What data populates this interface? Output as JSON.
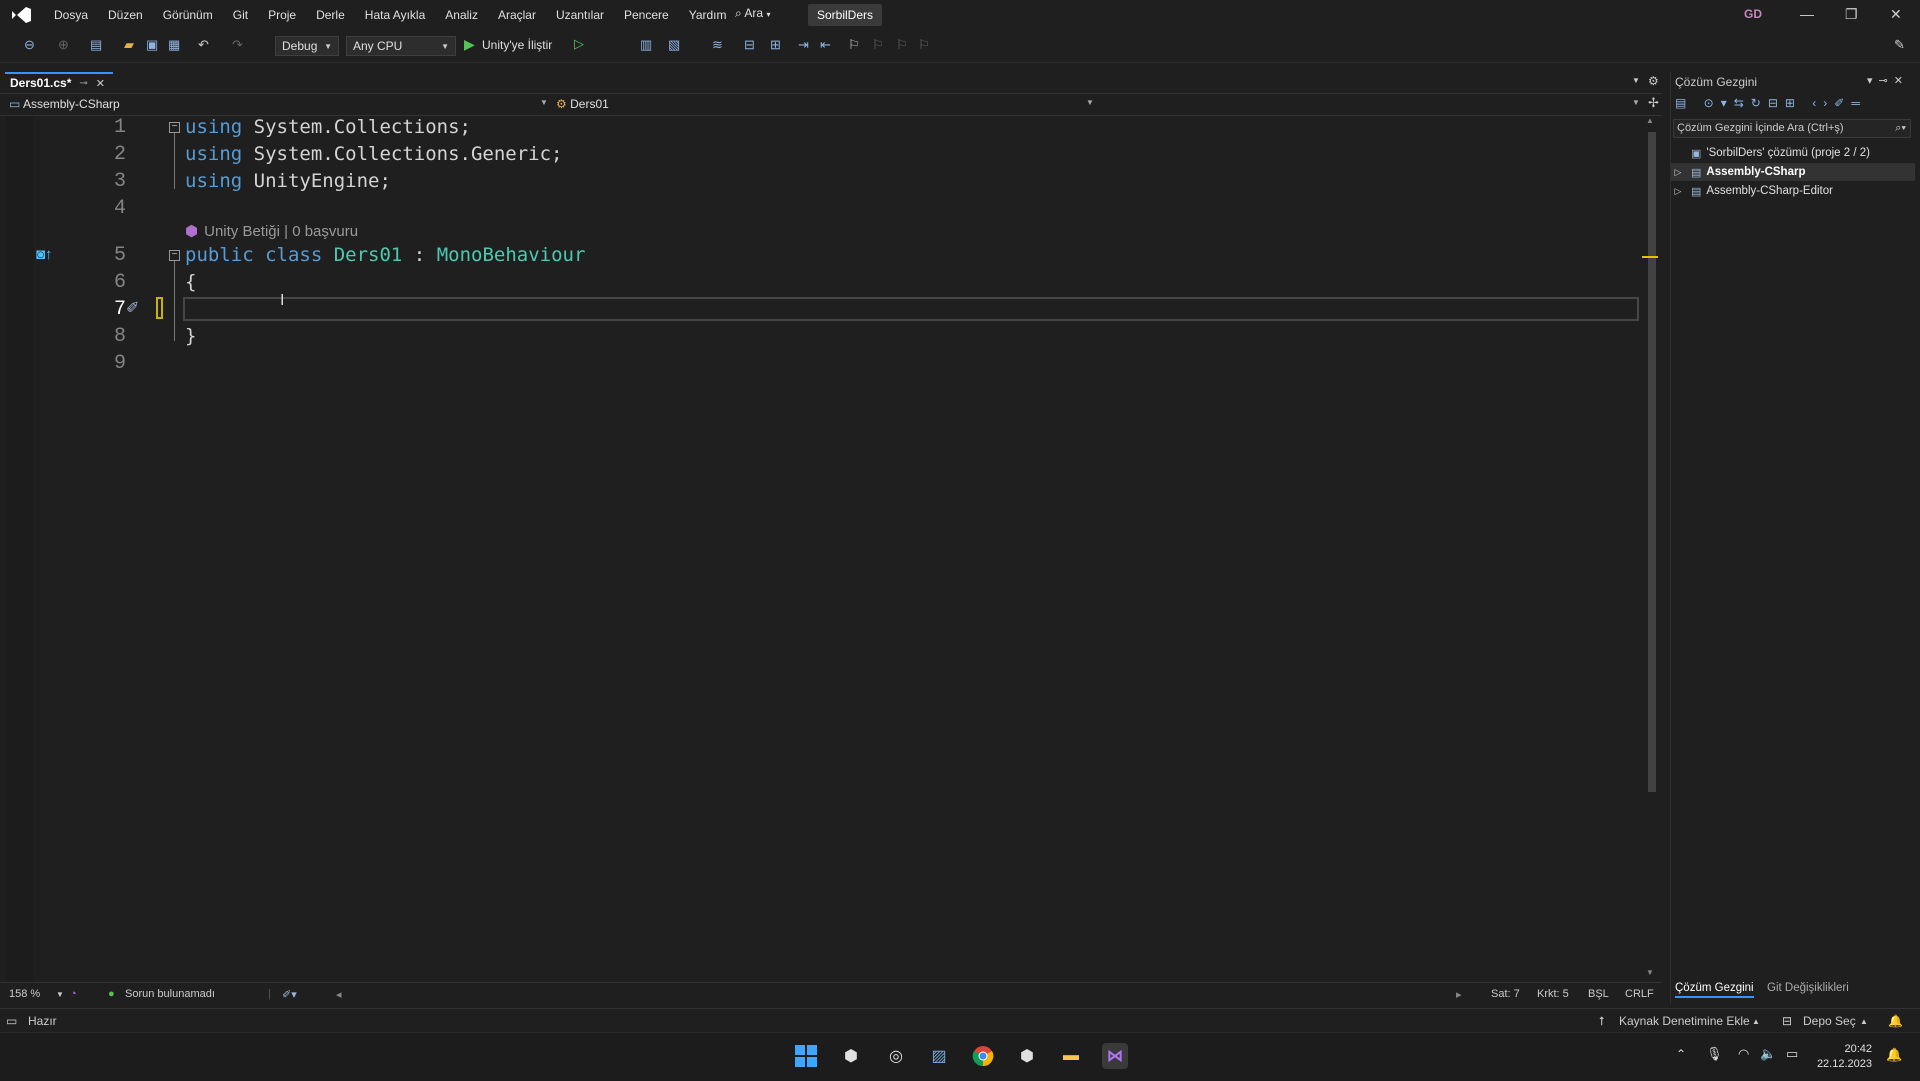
{
  "menubar": {
    "items": [
      "Dosya",
      "Düzen",
      "Görünüm",
      "Git",
      "Proje",
      "Derle",
      "Hata Ayıkla",
      "Analiz",
      "Araçlar",
      "Uzantılar",
      "Pencere",
      "Yardım"
    ],
    "search_label": "Ara",
    "project_name": "SorbilDers",
    "user_initials": "GD"
  },
  "toolbar": {
    "config": "Debug",
    "platform": "Any CPU",
    "run_label": "Unity'ye İliştir"
  },
  "editor": {
    "tab_label": "Ders01.cs*",
    "nav_project": "Assembly-CSharp",
    "nav_class": "Ders01",
    "line_numbers": [
      "1",
      "2",
      "3",
      "4",
      "5",
      "6",
      "7",
      "8",
      "9"
    ],
    "lines": {
      "l1_kw": "using",
      "l1_rest": " System.Collections;",
      "l2_kw": "using",
      "l2_rest": " System.Collections.Generic;",
      "l3_kw": "using",
      "l3_rest": " UnityEngine;",
      "l5_kw1": "public",
      "l5_kw2": " class",
      "l5_name": " Ders01",
      "l5_colon": " : ",
      "l5_base": "MonoBehaviour",
      "l6": "{",
      "l8": "}"
    },
    "codelens": "Unity Betiği | 0 başvuru",
    "zoom": "158 %",
    "issues": "Sorun bulunamadı",
    "line_pos": "Sat: 7",
    "col_pos": "Krkt: 5",
    "indent": "BŞL",
    "eol": "CRLF"
  },
  "solution": {
    "title": "Çözüm Gezgini",
    "search_placeholder": "Çözüm Gezgini İçinde Ara (Ctrl+ş)",
    "root": "'SorbilDers' çözümü (proje 2 / 2)",
    "projects": [
      "Assembly-CSharp",
      "Assembly-CSharp-Editor"
    ],
    "tab_solution": "Çözüm Gezgini",
    "tab_git": "Git Değişiklikleri"
  },
  "statusbar": {
    "ready": "Hazır",
    "source_control": "Kaynak Denetimine Ekle",
    "repo": "Depo Seç"
  },
  "taskbar": {
    "time": "20:42",
    "date": "22.12.2023"
  }
}
